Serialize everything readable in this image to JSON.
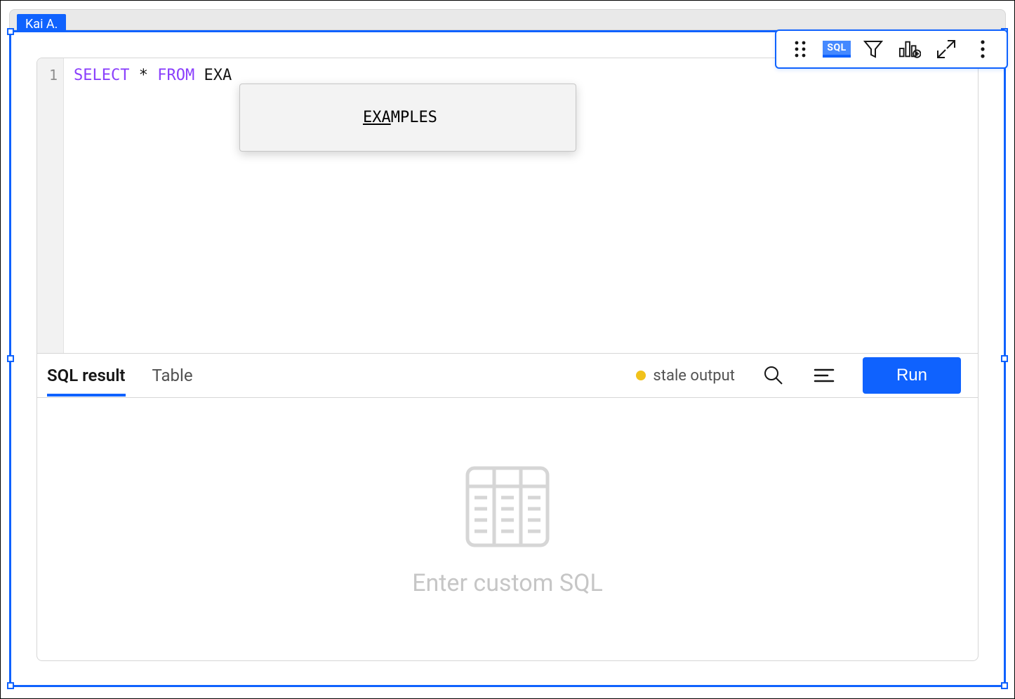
{
  "user": "Kai A.",
  "editor": {
    "line_number": "1",
    "sql_keyword_select": "SELECT",
    "sql_star": "*",
    "sql_keyword_from": "FROM",
    "sql_identifier": "EXA",
    "autocomplete_match": "EXA",
    "autocomplete_rest": "MPLES"
  },
  "toolbar": {
    "sql_badge": "SQL"
  },
  "result_bar": {
    "tabs": {
      "sql_result": "SQL result",
      "table": "Table"
    },
    "stale_label": "stale output",
    "run_label": "Run"
  },
  "empty_state": {
    "message": "Enter custom SQL"
  }
}
